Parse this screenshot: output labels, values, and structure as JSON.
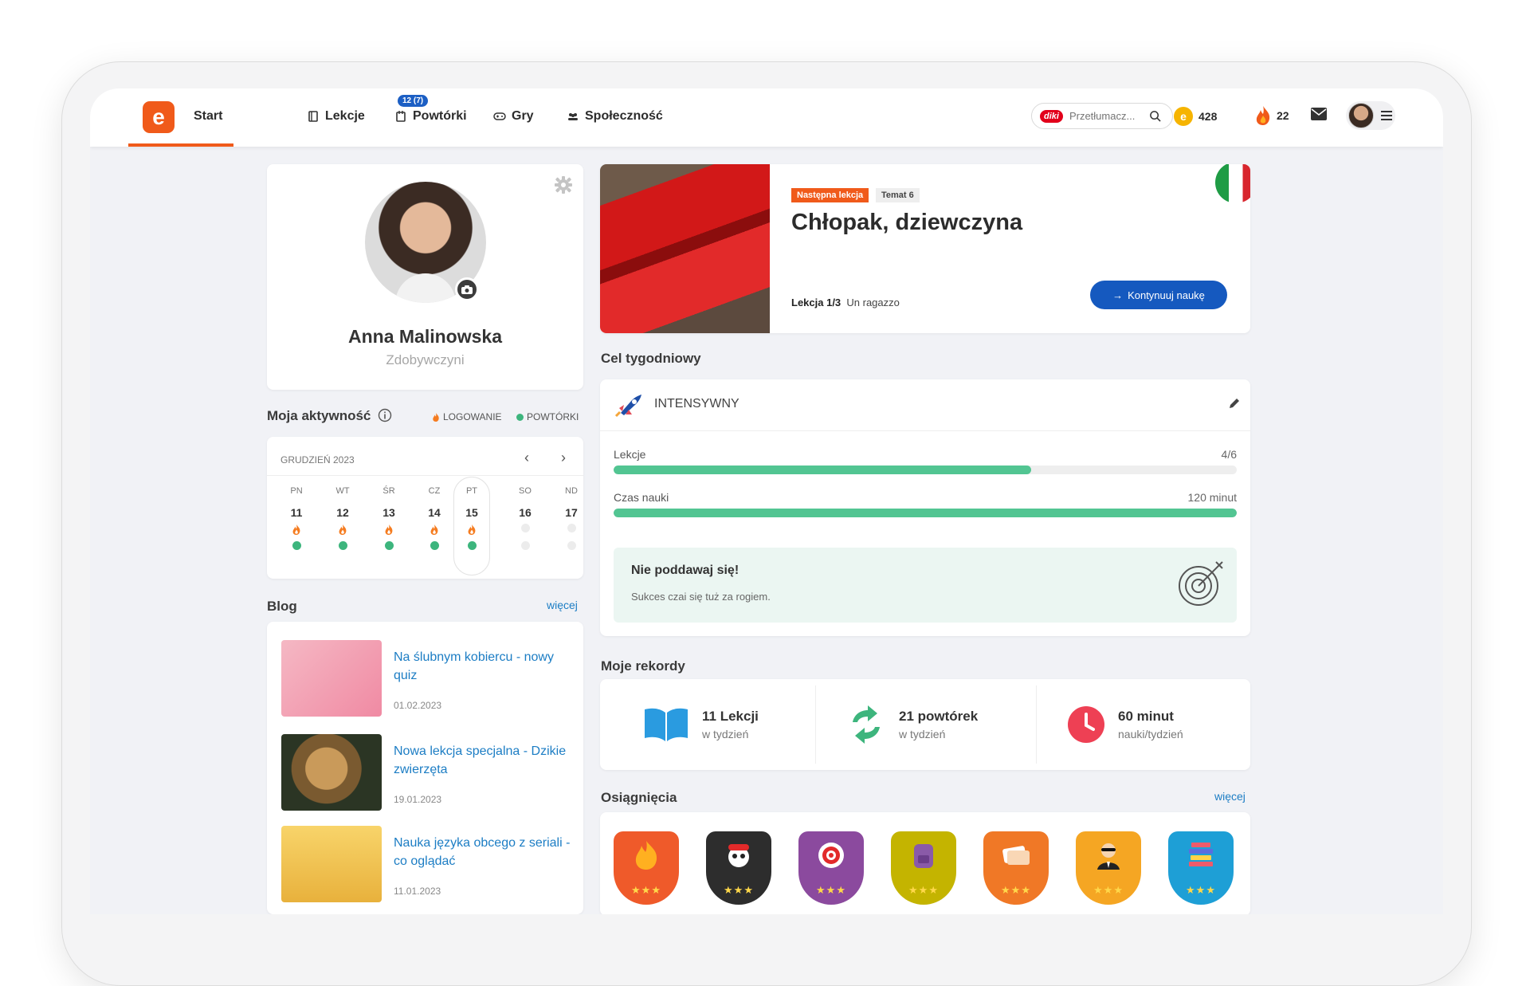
{
  "nav": {
    "logo": "e",
    "items": [
      {
        "label": "Start"
      },
      {
        "label": "Lekcje"
      },
      {
        "label": "Powtórki",
        "badge": "12 (7)"
      },
      {
        "label": "Gry"
      },
      {
        "label": "Społeczność"
      }
    ],
    "search_brand": "diki",
    "search_placeholder": "Przetłumacz...",
    "coins": "428",
    "streak": "22"
  },
  "profile": {
    "name": "Anna Malinowska",
    "rank": "Zdobywczyni"
  },
  "activity": {
    "title": "Moja aktywność",
    "legend_login": "LOGOWANIE",
    "legend_review": "POWTÓRKI",
    "month": "GRUDZIEŃ 2023",
    "days": [
      {
        "name": "PN",
        "date": "11",
        "login": true,
        "review": true
      },
      {
        "name": "WT",
        "date": "12",
        "login": true,
        "review": true
      },
      {
        "name": "ŚR",
        "date": "13",
        "login": true,
        "review": true
      },
      {
        "name": "CZ",
        "date": "14",
        "login": true,
        "review": true
      },
      {
        "name": "PT",
        "date": "15",
        "login": true,
        "review": true
      },
      {
        "name": "SO",
        "date": "16",
        "login": false,
        "review": false
      },
      {
        "name": "ND",
        "date": "17",
        "login": false,
        "review": false
      }
    ]
  },
  "blog": {
    "title": "Blog",
    "more": "więcej",
    "posts": [
      {
        "title": "Na ślubnym kobiercu - nowy quiz",
        "date": "01.02.2023"
      },
      {
        "title": "Nowa lekcja specjalna - Dzikie zwierzęta",
        "date": "19.01.2023"
      },
      {
        "title": "Nauka języka obcego z seriali - co oglądać",
        "date": "11.01.2023"
      }
    ]
  },
  "lesson": {
    "tag_next": "Następna lekcja",
    "tag_topic": "Temat 6",
    "title": "Chłopak, dziewczyna",
    "progress": "Lekcja 1/3",
    "phrase": "Un ragazzo",
    "cta": "Kontynuuj naukę"
  },
  "goal": {
    "section": "Cel tygodniowy",
    "level": "INTENSYWNY",
    "bars": [
      {
        "label": "Lekcje",
        "value": "4/6",
        "fraction": 0.67
      },
      {
        "label": "Czas nauki",
        "value": "120 minut",
        "fraction": 1.0
      }
    ],
    "motivation_title": "Nie poddawaj się!",
    "motivation_text": "Sukces czai się tuż za rogiem."
  },
  "records": {
    "section": "Moje rekordy",
    "items": [
      {
        "value": "11 Lekcji",
        "sub": "w tydzień"
      },
      {
        "value": "21 powtórek",
        "sub": "w tydzień"
      },
      {
        "value": "60 minut",
        "sub": "nauki/tydzień"
      }
    ]
  },
  "achievements": {
    "section": "Osiągnięcia",
    "more": "więcej",
    "badges": [
      {
        "icon": "fire-badge-icon",
        "color": "#ef5a2a"
      },
      {
        "icon": "pirate-badge-icon",
        "color": "#2d2d2d"
      },
      {
        "icon": "target-badge-icon",
        "color": "#8b4a9e"
      },
      {
        "icon": "backpack-badge-icon",
        "color": "#c4b400"
      },
      {
        "icon": "cards-badge-icon",
        "color": "#f07826"
      },
      {
        "icon": "agent-badge-icon",
        "color": "#f5a623"
      },
      {
        "icon": "books-badge-icon",
        "color": "#1e9fd6"
      }
    ]
  },
  "colors": {
    "accent": "#f05a1a",
    "primary": "#1559bf",
    "success": "#52c592"
  }
}
